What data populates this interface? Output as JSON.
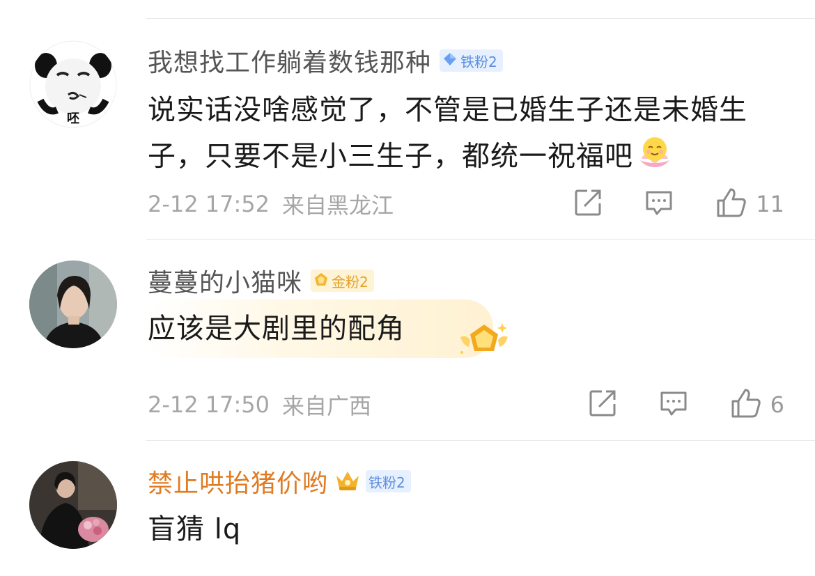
{
  "comments": [
    {
      "username": "我想找工作躺着数钱那种",
      "badge": "铁粉2",
      "badge_type": "iron",
      "avatar_caption": "呸",
      "content": "说实话没啥感觉了，不管是已婚生子还是未婚生子，只要不是小三生子，都统一祝福吧",
      "emoji": "lotus-smile-emoji",
      "timestamp": "2-12 17:52",
      "location": "来自黑龙江",
      "likes": "11"
    },
    {
      "username": "蔓蔓的小猫咪",
      "badge": "金粉2",
      "badge_type": "gold",
      "content": "应该是大剧里的配角",
      "timestamp": "2-12 17:50",
      "location": "来自广西",
      "likes": "6"
    },
    {
      "username": "禁止哄抬猪价哟",
      "badge": "铁粉2",
      "badge_type": "iron",
      "content": "盲猜 lq"
    }
  ],
  "icons": {
    "share": "share-icon",
    "reply": "comment-icon",
    "like": "thumbs-up-icon",
    "badge_iron": "diamond-icon",
    "badge_gold": "pentagon-icon",
    "crown": "crown-icon"
  },
  "colors": {
    "username": "#555555",
    "username_vip": "#e07b22",
    "meta": "#a6a6a6",
    "badge_iron_bg": "#e7f0ff",
    "badge_iron_text": "#5b8fe0",
    "badge_gold_bg": "#fff3d6",
    "badge_gold_text": "#e3a12a"
  }
}
